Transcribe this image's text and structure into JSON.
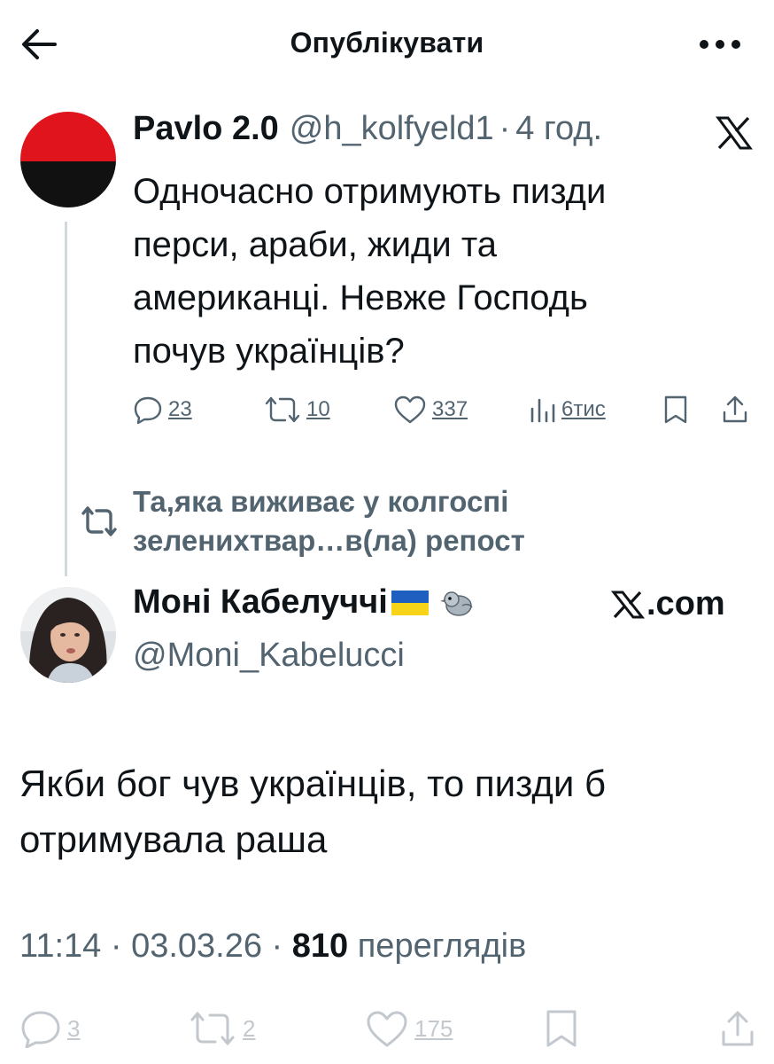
{
  "header": {
    "title": "Опублікувати",
    "back_icon": "arrow-left-icon",
    "more_icon": "more-horizontal-icon"
  },
  "tweet1": {
    "name": "Pavlo 2.0",
    "handle": "@h_kolfyeld1",
    "separator": "·",
    "time": "4 год.",
    "text": "Одночасно отримують пизди\nперси, араби, жиди та\nамериканці. Невже Господь\nпочув українців?",
    "avatar_colors": {
      "top": "#e0141c",
      "bottom": "#111111"
    },
    "actions": {
      "replies": "23",
      "reposts": "10",
      "likes": "337",
      "views": "6тис"
    }
  },
  "repost_note": "Та,яка виживає у колгоспі\nзеленихтвар…в(ла) репост",
  "tweet2": {
    "name": "Моні Кабелуччі",
    "site": ".com",
    "handle": "@Moni_Kabelucci",
    "text": "Якби бог чув українців, то пизди б\nотримувала раша"
  },
  "meta": {
    "time": "11:14",
    "separator": "·",
    "date": "03.03.26",
    "views": "810",
    "views_label": "переглядів"
  },
  "bottom_actions": {
    "replies": "3",
    "reposts": "2",
    "likes": "175"
  },
  "colors": {
    "text": "#0f1419",
    "secondary": "#536471",
    "divider": "#cfd9de"
  }
}
